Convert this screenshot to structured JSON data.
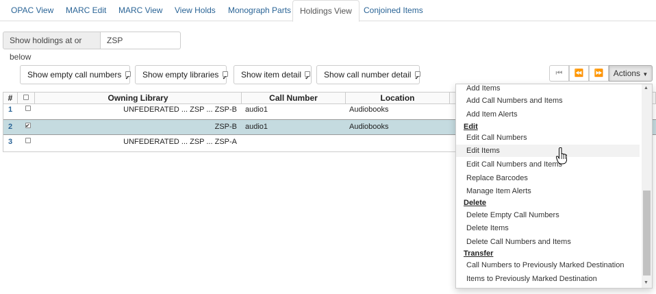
{
  "tabs": [
    "OPAC View",
    "MARC Edit",
    "MARC View",
    "View Holds",
    "Monograph Parts",
    "Holdings View",
    "Conjoined Items"
  ],
  "active_tab": "Holdings View",
  "holdings_filter": {
    "label": "Show holdings at or below",
    "value": "ZSP"
  },
  "toggles": [
    {
      "label": "Show empty call numbers",
      "checked": true
    },
    {
      "label": "Show empty libraries",
      "checked": true
    },
    {
      "label": "Show item detail",
      "checked": true
    },
    {
      "label": "Show call number detail",
      "checked": true
    }
  ],
  "pager": {
    "first_icon": "first-page-icon",
    "prev_icon": "previous-page-icon",
    "next_icon": "next-page-icon"
  },
  "actions_label": "Actions",
  "grid": {
    "columns": [
      "#",
      "Owning Library",
      "Call Number",
      "Location"
    ],
    "rows": [
      {
        "num": "1",
        "library": "UNFEDERATED ... ZSP ... ZSP-B",
        "call_number": "audio1",
        "location": "Audiobooks",
        "checked": false,
        "selected": false
      },
      {
        "num": "2",
        "library": "ZSP-B",
        "call_number": "audio1",
        "location": "Audiobooks",
        "checked": true,
        "selected": true
      },
      {
        "num": "3",
        "library": "UNFEDERATED ... ZSP ... ZSP-A",
        "call_number": "",
        "location": "",
        "checked": false,
        "selected": false
      }
    ]
  },
  "menu": {
    "items_top": [
      "Add Items",
      "Add Call Numbers and Items",
      "Add Item Alerts"
    ],
    "edit_header": "Edit",
    "edit_items": [
      "Edit Call Numbers",
      "Edit Items",
      "Edit Call Numbers and Items",
      "Replace Barcodes",
      "Manage Item Alerts"
    ],
    "delete_header": "Delete",
    "delete_items": [
      "Delete Empty Call Numbers",
      "Delete Items",
      "Delete Call Numbers and Items"
    ],
    "transfer_header": "Transfer",
    "transfer_items": [
      "Call Numbers to Previously Marked Destination",
      "Items to Previously Marked Destination"
    ],
    "hovered": "Edit Items"
  },
  "colors": {
    "link": "#2a6496",
    "selected_row": "#c5dbe0"
  }
}
